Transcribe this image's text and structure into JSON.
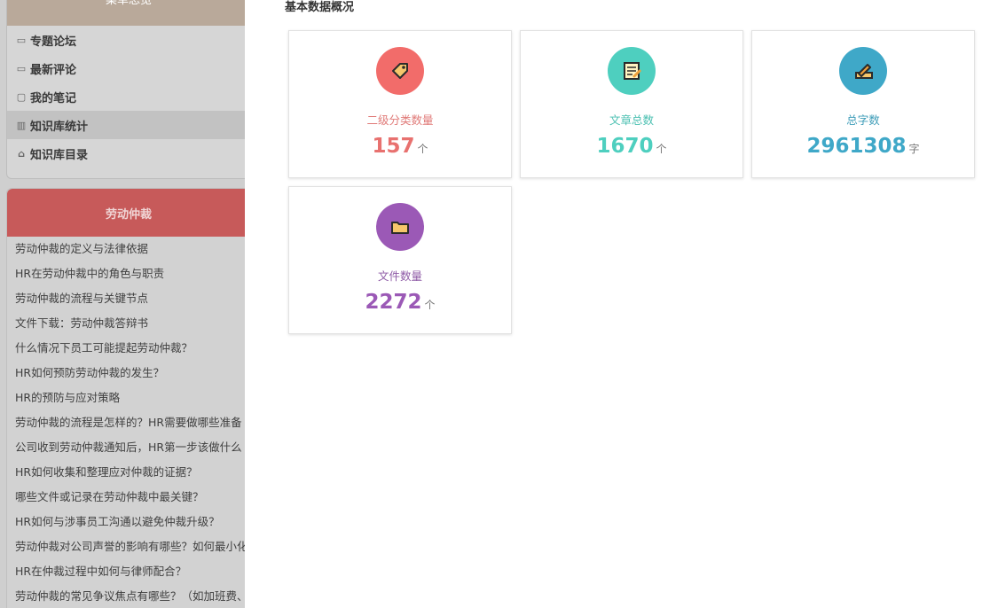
{
  "menu": {
    "header": "菜单总览",
    "items": [
      {
        "label": "专题论坛",
        "icon": "forum-icon"
      },
      {
        "label": "最新评论",
        "icon": "comment-icon"
      },
      {
        "label": "我的笔记",
        "icon": "note-icon"
      },
      {
        "label": "知识库统计",
        "icon": "bar-chart-icon",
        "active": true
      },
      {
        "label": "知识库目录",
        "icon": "home-icon"
      }
    ]
  },
  "topic": {
    "header": "劳动仲裁",
    "items": [
      "劳动仲裁的定义与法律依据",
      "HR在劳动仲裁中的角色与职责",
      "劳动仲裁的流程与关键节点",
      "文件下载：劳动仲裁答辩书",
      "什么情况下员工可能提起劳动仲裁？",
      "HR如何预防劳动仲裁的发生？",
      "HR的预防与应对策略",
      "劳动仲裁的流程是怎样的？HR需要做哪些准备",
      "公司收到劳动仲裁通知后，HR第一步该做什么",
      "HR如何收集和整理应对仲裁的证据？",
      "哪些文件或记录在劳动仲裁中最关键？",
      "HR如何与涉事员工沟通以避免仲裁升级？",
      "劳动仲裁对公司声誉的影响有哪些？如何最小化",
      "HR在仲裁过程中如何与律师配合？",
      "劳动仲裁的常见争议焦点有哪些？（如加班费、"
    ]
  },
  "main": {
    "section_title": "基本数据概况",
    "stats": [
      {
        "label": "二级分类数量",
        "value": "157",
        "unit": "个",
        "color": "#e8716f",
        "icon": "tag-icon"
      },
      {
        "label": "文章总数",
        "value": "1670",
        "unit": "个",
        "color": "#4ecfbf",
        "icon": "document-icon"
      },
      {
        "label": "总字数",
        "value": "2961308",
        "unit": "字",
        "color": "#3fa8c8",
        "icon": "pen-write-icon"
      },
      {
        "label": "文件数量",
        "value": "2272",
        "unit": "个",
        "color": "#9b59b6",
        "icon": "folder-icon"
      }
    ]
  },
  "colors": {
    "label_1": "#e07a78",
    "label_2": "#48bfb0",
    "label_3": "#3d9cb8",
    "label_4": "#8e5aa6"
  }
}
